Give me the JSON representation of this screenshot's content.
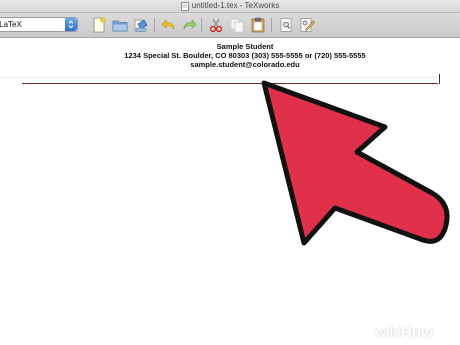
{
  "window": {
    "title": "untitled-1.tex - TeXworks"
  },
  "toolbar": {
    "engine_value": "pdfLaTeX",
    "buttons": [
      {
        "icon": "new-document-icon"
      },
      {
        "icon": "open-folder-icon"
      },
      {
        "icon": "save-icon"
      },
      {
        "icon": "undo-icon"
      },
      {
        "icon": "redo-icon"
      },
      {
        "icon": "cut-icon"
      },
      {
        "icon": "copy-icon"
      },
      {
        "icon": "paste-icon"
      },
      {
        "icon": "find-icon"
      },
      {
        "icon": "replace-icon"
      }
    ]
  },
  "document": {
    "name_line": "Sample Student",
    "address_line": "1234 Special St. Boulder, CO 80303 (303) 555-5555 or (720) 555-5555",
    "email_line": "sample.student@colorado.edu"
  },
  "overlay": {
    "arrow_color": "#e0304a",
    "arrow_outline": "#111111"
  },
  "watermark": {
    "wiki": "wiki",
    "how": "How"
  }
}
